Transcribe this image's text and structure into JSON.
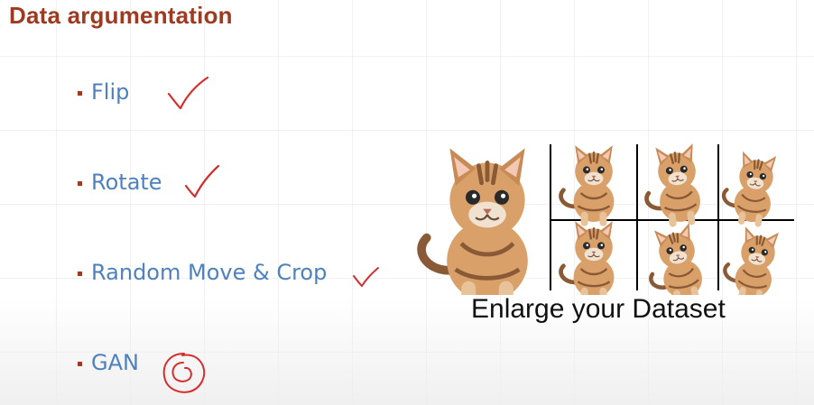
{
  "slide": {
    "title": "Data argumentation",
    "bullets": [
      {
        "text": "Flip",
        "annotation": "check-mark"
      },
      {
        "text": "Rotate",
        "annotation": "check-mark"
      },
      {
        "text": "Random Move & Crop",
        "annotation": "check-mark"
      },
      {
        "text": "GAN",
        "annotation": "circle-mark"
      }
    ],
    "caption": "Enlarge your Dataset",
    "colors": {
      "title": "#9c3b22",
      "bullet_marker": "#9c3b22",
      "bullet_text": "#4f81bd",
      "ink": "#d32f2f",
      "caption": "#111111"
    },
    "images": {
      "main": "kitten-photo",
      "grid": [
        "kitten-photo",
        "kitten-photo",
        "kitten-photo",
        "kitten-photo",
        "kitten-photo",
        "kitten-photo"
      ]
    }
  }
}
